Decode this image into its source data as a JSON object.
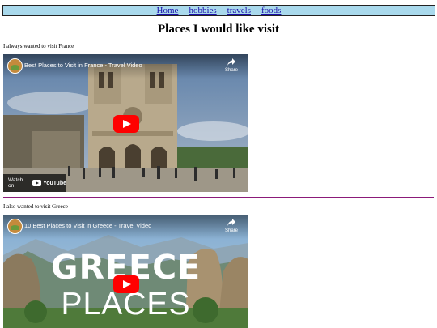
{
  "nav": {
    "links": [
      "Home",
      "hobbies",
      "travels",
      "foods"
    ],
    "background": "#a9d9ec",
    "link_color": "#1a0dab"
  },
  "page_title": "Places I would like visit",
  "sections": [
    {
      "caption": "I always wanted to visit France",
      "video": {
        "title": "Best Places to Visit in France - Travel Video",
        "share_label": "Share",
        "watch_on_label": "Watch on",
        "youtube_label": "YouTube"
      }
    },
    {
      "caption": "I also wanted to visit Greece",
      "video": {
        "title": "10 Best Places to Visit in Greece - Travel Video",
        "share_label": "Share",
        "overlay_line1": "GREECE",
        "overlay_line2": "PLACES"
      }
    }
  ],
  "divider_color": "#8b1a79",
  "play_button_color": "#ff0000"
}
